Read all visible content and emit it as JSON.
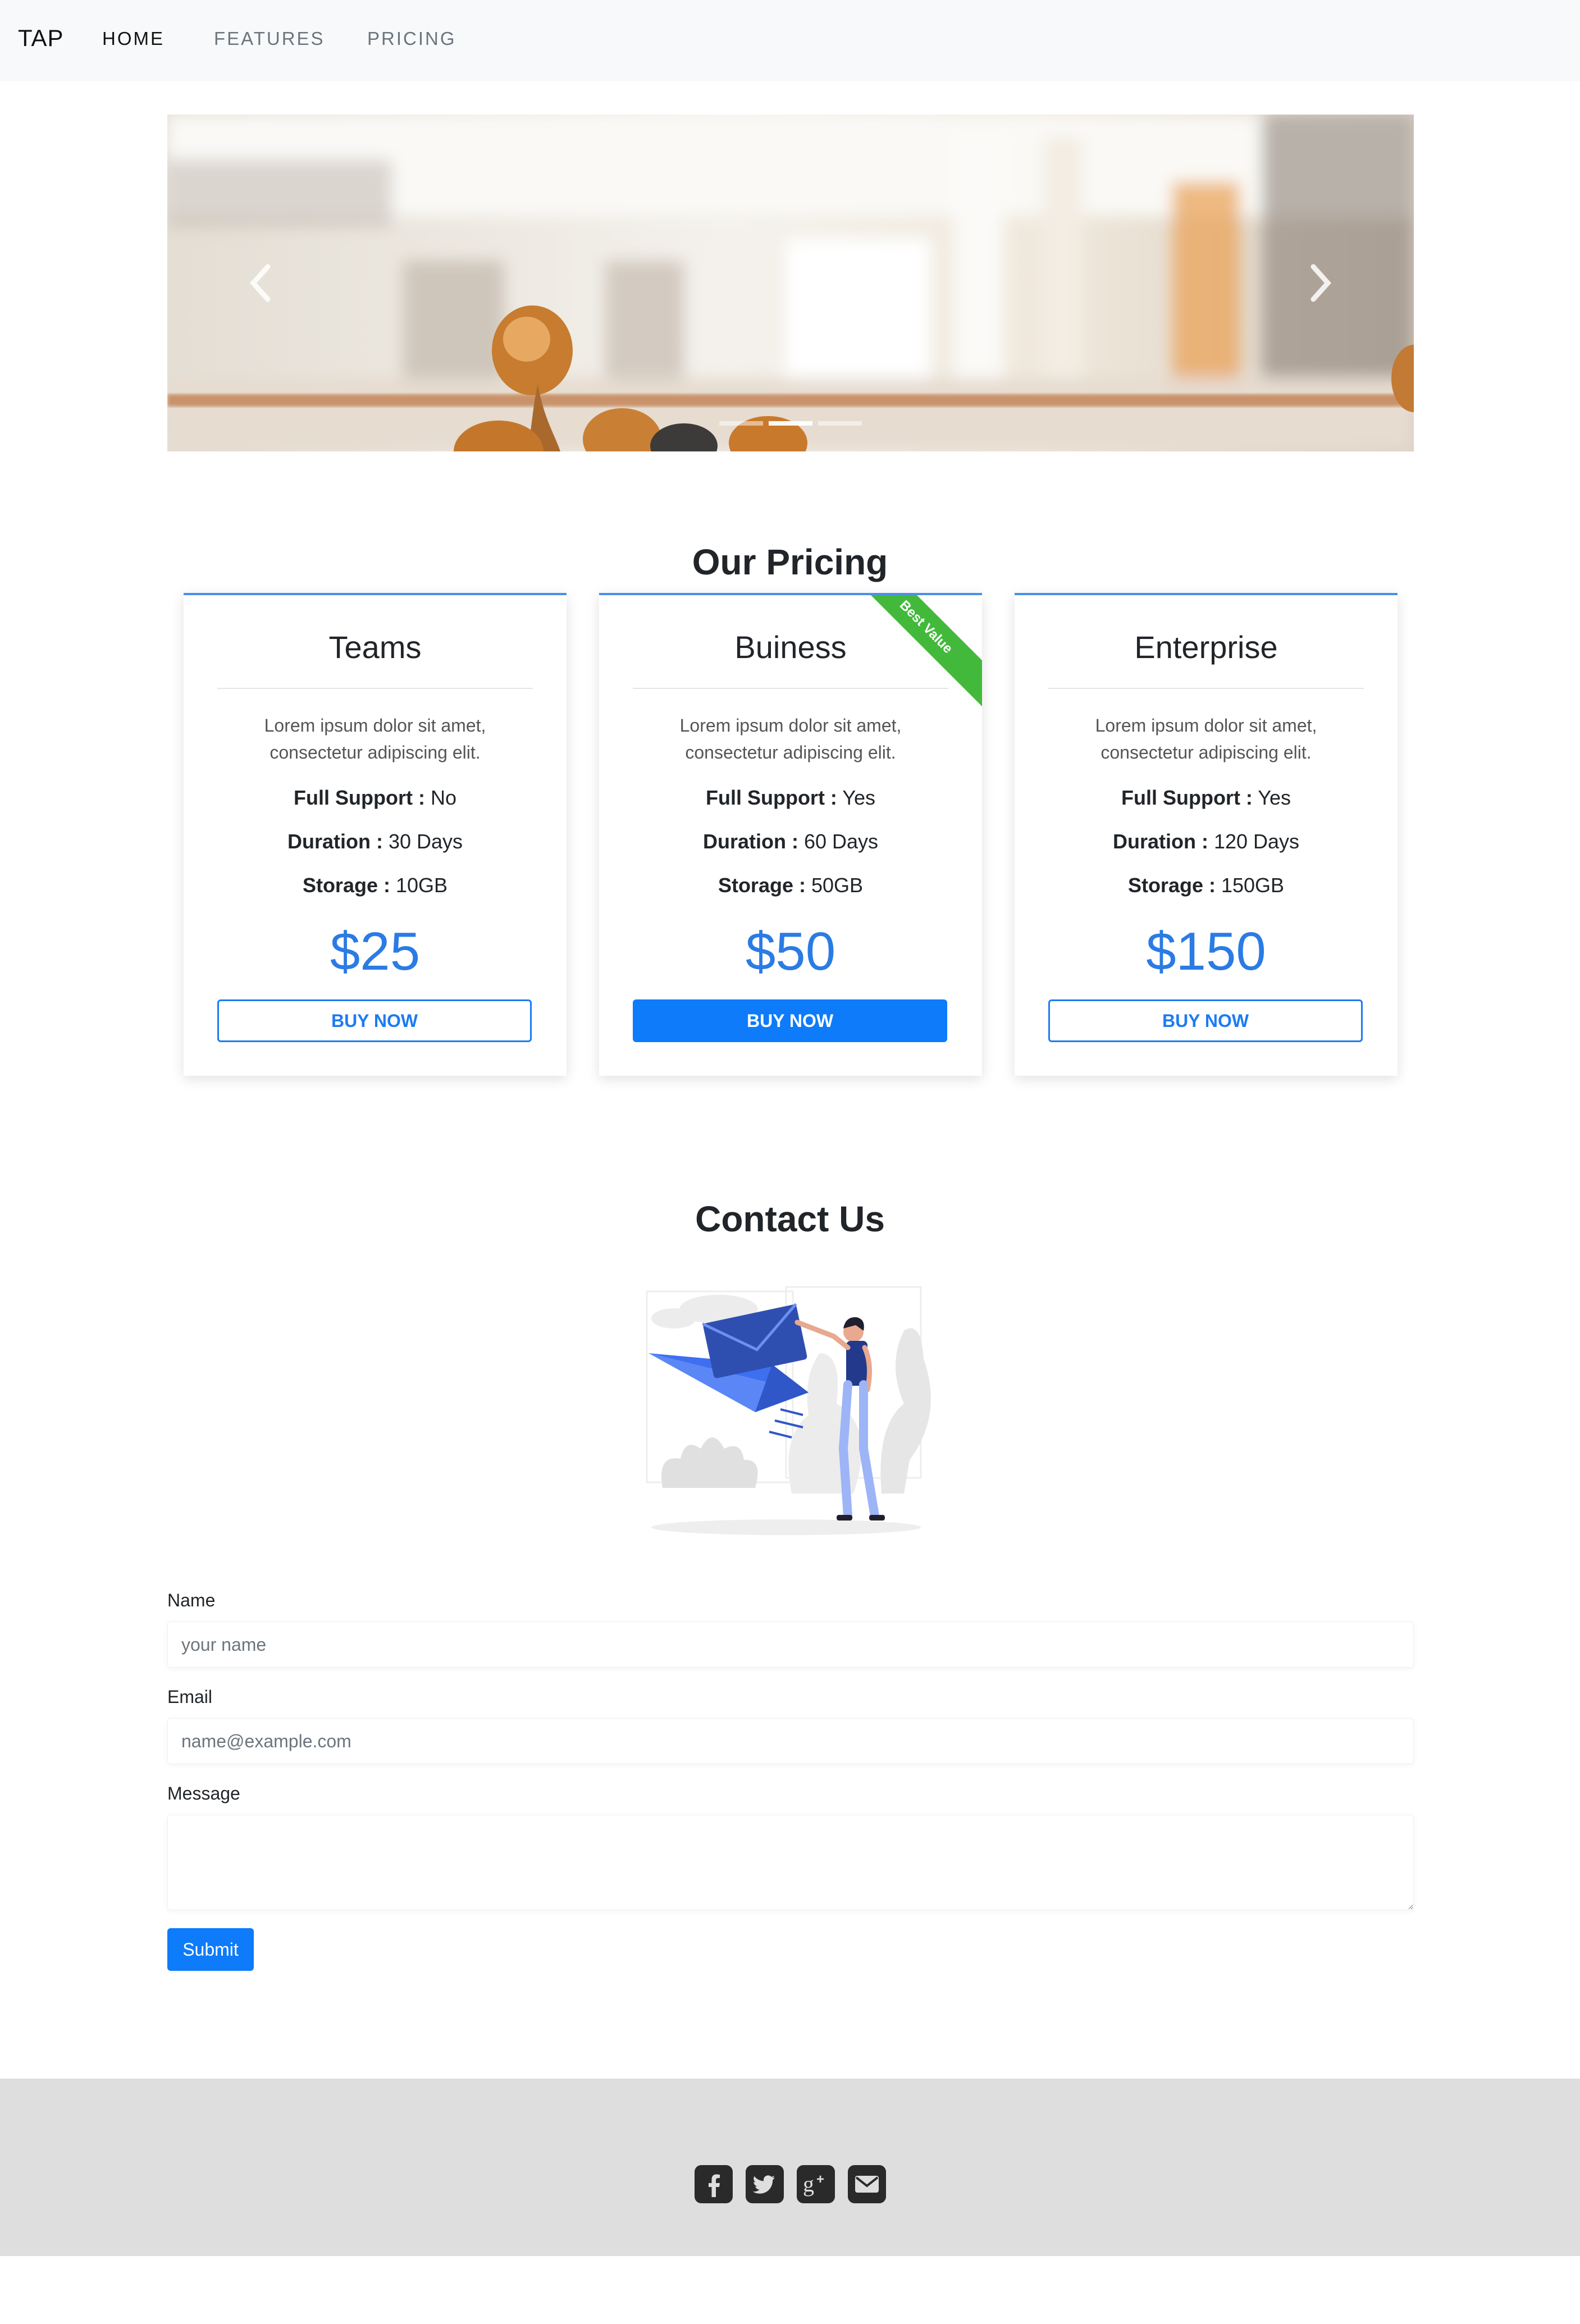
{
  "nav": {
    "brand": "TAP",
    "items": [
      {
        "label": "HOME",
        "active": true
      },
      {
        "label": "FEATURES",
        "active": false
      },
      {
        "label": "PRICING",
        "active": false
      }
    ]
  },
  "carousel": {
    "prev_icon": "chevron-left-icon",
    "next_icon": "chevron-right-icon",
    "slide_count": 3,
    "active_slide": 1
  },
  "pricing": {
    "title": "Our Pricing",
    "plans": [
      {
        "name": "Teams",
        "description": "Lorem ipsum dolor sit amet, consectetur adipiscing elit.",
        "support_label": "Full Support :",
        "support_value": "No",
        "duration_label": "Duration :",
        "duration_value": "30 Days",
        "storage_label": "Storage :",
        "storage_value": "10GB",
        "price": "$25",
        "button": "BUY NOW"
      },
      {
        "name": "Buiness",
        "description": "Lorem ipsum dolor sit amet, consectetur adipiscing elit.",
        "support_label": "Full Support :",
        "support_value": "Yes",
        "duration_label": "Duration :",
        "duration_value": "60 Days",
        "storage_label": "Storage :",
        "storage_value": "50GB",
        "price": "$50",
        "button": "BUY NOW",
        "ribbon": "Best Value"
      },
      {
        "name": "Enterprise",
        "description": "Lorem ipsum dolor sit amet, consectetur adipiscing elit.",
        "support_label": "Full Support :",
        "support_value": "Yes",
        "duration_label": "Duration :",
        "duration_value": "120 Days",
        "storage_label": "Storage :",
        "storage_value": "150GB",
        "price": "$150",
        "button": "BUY NOW"
      }
    ]
  },
  "contact": {
    "title": "Contact Us",
    "name_label": "Name",
    "name_placeholder": "your name",
    "email_label": "Email",
    "email_placeholder": "name@example.com",
    "message_label": "Message",
    "submit": "Submit"
  },
  "footer": {
    "icons": [
      "facebook-icon",
      "twitter-icon",
      "google-plus-icon",
      "envelope-icon"
    ]
  },
  "colors": {
    "accent": "#0d7bfa",
    "price": "#2b7be4",
    "ribbon": "#43b93c",
    "navbar_bg": "#f8f9fa",
    "footer_bg": "#dedede"
  }
}
